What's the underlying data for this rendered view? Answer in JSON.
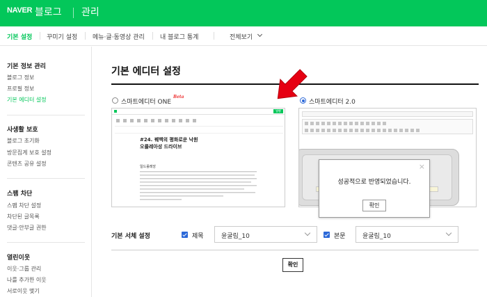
{
  "header": {
    "logo": "NAVER",
    "blog": "블로그",
    "title": "관리"
  },
  "tabs": [
    {
      "label": "기본 설정"
    },
    {
      "label": "꾸미기 설정"
    },
    {
      "label": "메뉴·글·동영상 관리"
    },
    {
      "label": "내 블로그 통계"
    },
    {
      "label": "전체보기"
    }
  ],
  "sidebar": {
    "sections": [
      {
        "title": "기본 정보 관리",
        "items": [
          "블로그 정보",
          "프로필 정보",
          "기본 에디터 설정"
        ]
      },
      {
        "title": "사생활 보호",
        "items": [
          "블로그 초기화",
          "방문집계 보호 설정",
          "콘텐츠 공유 설정"
        ]
      },
      {
        "title": "스팸 차단",
        "items": [
          "스팸 차단 설정",
          "차단된 글목록",
          "댓글·안부글 권한"
        ]
      },
      {
        "title": "열린이웃",
        "items": [
          "이웃·그룹 관리",
          "나를 추가한 이웃",
          "서로이웃 맺기"
        ]
      }
    ]
  },
  "main": {
    "title": "기본 에디터 설정",
    "options": [
      {
        "label": "스마트에디터 ONE",
        "badge": "Beta",
        "selected": false
      },
      {
        "label": "스마트에디터 2.0",
        "selected": true
      }
    ],
    "thumb_one": {
      "post_title": "#24. 꿰백의 평화로운 낙원\n오를레아성 드라이브",
      "subheading": "일드롤레앙",
      "publish": "발행"
    },
    "modal": {
      "message": "성공적으로 반영되었습니다.",
      "ok": "확인",
      "close": "×"
    },
    "font": {
      "label": "기본 서체 설정",
      "title_check_label": "제목",
      "title_font": "윤굴림_10",
      "body_check_label": "본문",
      "body_font": "윤굴림_10"
    },
    "confirm": "확인"
  },
  "colors": {
    "brand": "#03c75a",
    "accent": "#2b68d8",
    "arrow": "#e60012"
  }
}
